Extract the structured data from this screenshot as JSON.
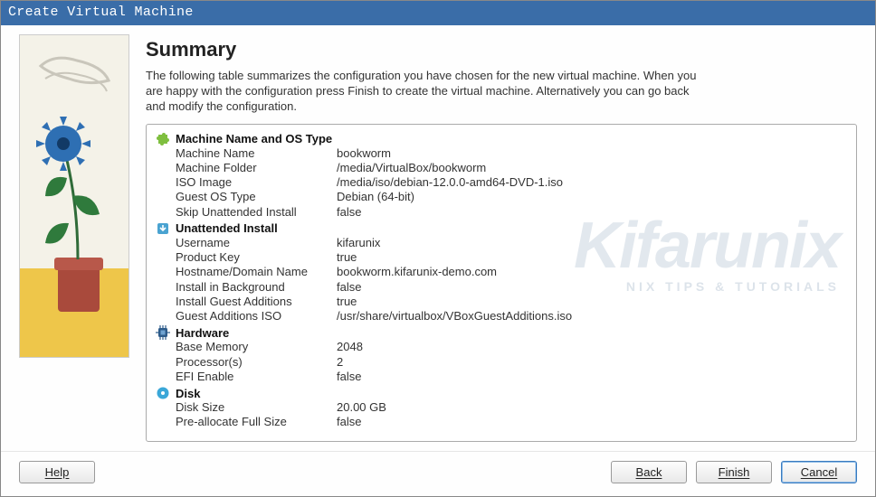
{
  "titlebar": "Create Virtual Machine",
  "page_title": "Summary",
  "description": "The following table summarizes the configuration you have chosen for the new virtual machine. When you are happy with the configuration press Finish to create the virtual machine. Alternatively you can go back and modify the configuration.",
  "sections": {
    "machine": {
      "header": "Machine Name and OS Type",
      "rows": [
        {
          "k": "Machine Name",
          "v": "bookworm"
        },
        {
          "k": "Machine Folder",
          "v": "/media/VirtualBox/bookworm"
        },
        {
          "k": "ISO Image",
          "v": "/media/iso/debian-12.0.0-amd64-DVD-1.iso"
        },
        {
          "k": "Guest OS Type",
          "v": "Debian (64-bit)"
        },
        {
          "k": "Skip Unattended Install",
          "v": "false"
        }
      ]
    },
    "unattended": {
      "header": "Unattended Install",
      "rows": [
        {
          "k": "Username",
          "v": "kifarunix"
        },
        {
          "k": "Product Key",
          "v": "true"
        },
        {
          "k": "Hostname/Domain Name",
          "v": "bookworm.kifarunix-demo.com"
        },
        {
          "k": "Install in Background",
          "v": "false"
        },
        {
          "k": "Install Guest Additions",
          "v": "true"
        },
        {
          "k": "Guest Additions ISO",
          "v": "/usr/share/virtualbox/VBoxGuestAdditions.iso"
        }
      ]
    },
    "hardware": {
      "header": "Hardware",
      "rows": [
        {
          "k": "Base Memory",
          "v": "2048"
        },
        {
          "k": "Processor(s)",
          "v": "2"
        },
        {
          "k": "EFI Enable",
          "v": "false"
        }
      ]
    },
    "disk": {
      "header": "Disk",
      "rows": [
        {
          "k": "Disk Size",
          "v": "20.00 GB"
        },
        {
          "k": "Pre-allocate Full Size",
          "v": "false"
        }
      ]
    }
  },
  "buttons": {
    "help": "Help",
    "back": "Back",
    "finish": "Finish",
    "cancel": "Cancel"
  },
  "watermark": {
    "main": "Kifarunix",
    "sub": "NIX TIPS & TUTORIALS"
  }
}
